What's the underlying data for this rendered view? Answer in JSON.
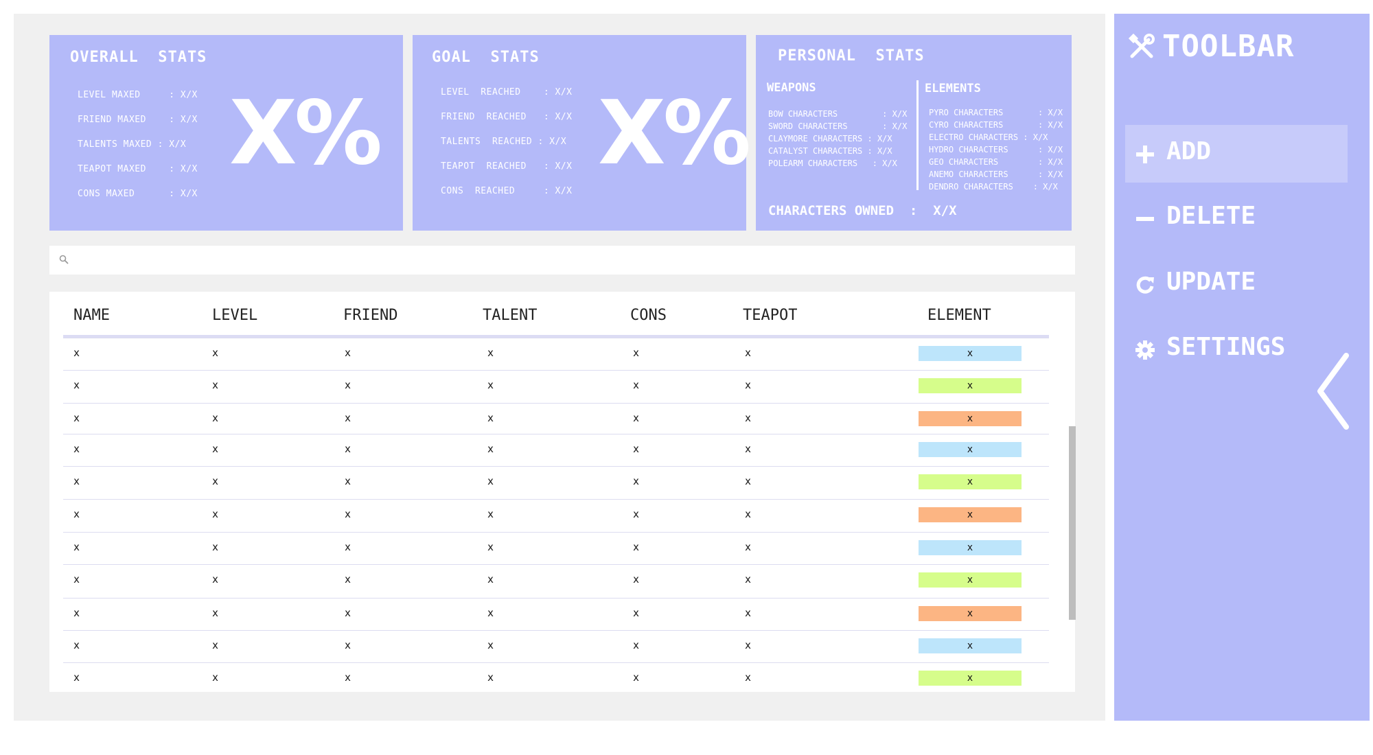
{
  "cards": {
    "overall": {
      "title": "OVERALL  STATS",
      "rows": [
        "LEVEL MAXED     : X/X",
        "FRIEND MAXED    : X/X",
        "TALENTS MAXED : X/X",
        "TEAPOT MAXED    : X/X",
        "CONS MAXED      : X/X"
      ],
      "percent": "X%"
    },
    "goal": {
      "title": "GOAL  STATS",
      "rows": [
        "LEVEL  REACHED    : X/X",
        "FRIEND  REACHED   : X/X",
        "TALENTS  REACHED : X/X",
        "TEAPOT  REACHED   : X/X",
        "CONS  REACHED     : X/X"
      ],
      "percent": "X%"
    },
    "personal": {
      "title": "PERSONAL  STATS",
      "weapons_heading": "WEAPONS",
      "weapons": [
        "BOW CHARACTERS         : X/X",
        "SWORD CHARACTERS       : X/X",
        "CLAYMORE CHARACTERS : X/X",
        "CATALYST CHARACTERS : X/X",
        "POLEARM CHARACTERS   : X/X"
      ],
      "elements_heading": "ELEMENTS",
      "elements": [
        "PYRO CHARACTERS       : X/X",
        "CYRO CHARACTERS       : X/X",
        "ELECTRO CHARACTERS : X/X",
        "HYDRO CHARACTERS      : X/X",
        "GEO CHARACTERS        : X/X",
        "ANEMO CHARACTERS      : X/X",
        "DENDRO CHARACTERS    : X/X"
      ],
      "owned": "CHARACTERS OWNED  :  X/X"
    }
  },
  "search": {
    "placeholder": "",
    "icon": "search-icon"
  },
  "table": {
    "headers": [
      "NAME",
      "LEVEL",
      "FRIEND",
      "TALENT",
      "CONS",
      "TEAPOT",
      "ELEMENT"
    ],
    "rows": [
      {
        "name": "x",
        "level": "x",
        "friend": "x",
        "talent": "x",
        "cons": "x",
        "teapot": "x",
        "element": "x",
        "element_color": "#bde5fb"
      },
      {
        "name": "x",
        "level": "x",
        "friend": "x",
        "talent": "x",
        "cons": "x",
        "teapot": "x",
        "element": "x",
        "element_color": "#d6fd8b"
      },
      {
        "name": "x",
        "level": "x",
        "friend": "x",
        "talent": "x",
        "cons": "x",
        "teapot": "x",
        "element": "x",
        "element_color": "#fcb583"
      },
      {
        "name": "x",
        "level": "x",
        "friend": "x",
        "talent": "x",
        "cons": "x",
        "teapot": "x",
        "element": "x",
        "element_color": "#bde5fb"
      },
      {
        "name": "x",
        "level": "x",
        "friend": "x",
        "talent": "x",
        "cons": "x",
        "teapot": "x",
        "element": "x",
        "element_color": "#d6fd8b"
      },
      {
        "name": "x",
        "level": "x",
        "friend": "x",
        "talent": "x",
        "cons": "x",
        "teapot": "x",
        "element": "x",
        "element_color": "#fcb583"
      },
      {
        "name": "x",
        "level": "x",
        "friend": "x",
        "talent": "x",
        "cons": "x",
        "teapot": "x",
        "element": "x",
        "element_color": "#bde5fb"
      },
      {
        "name": "x",
        "level": "x",
        "friend": "x",
        "talent": "x",
        "cons": "x",
        "teapot": "x",
        "element": "x",
        "element_color": "#d6fd8b"
      },
      {
        "name": "x",
        "level": "x",
        "friend": "x",
        "talent": "x",
        "cons": "x",
        "teapot": "x",
        "element": "x",
        "element_color": "#fcb583"
      },
      {
        "name": "x",
        "level": "x",
        "friend": "x",
        "talent": "x",
        "cons": "x",
        "teapot": "x",
        "element": "x",
        "element_color": "#bde5fb"
      },
      {
        "name": "x",
        "level": "x",
        "friend": "x",
        "talent": "x",
        "cons": "x",
        "teapot": "x",
        "element": "x",
        "element_color": "#d6fd8b"
      }
    ]
  },
  "toolbar": {
    "title": "TOOLBAR",
    "title_icon": "tools-icon",
    "items": [
      {
        "label": "ADD",
        "icon": "plus-icon"
      },
      {
        "label": "DELETE",
        "icon": "minus-icon"
      },
      {
        "label": "UPDATE",
        "icon": "refresh-icon"
      },
      {
        "label": "SETTINGS",
        "icon": "gear-icon"
      }
    ],
    "collapse_icon": "chevron-left-icon"
  },
  "colors": {
    "accent": "#b4baf9",
    "panel_bg": "#f0f0f0",
    "pyro": "#fcb583",
    "dendro": "#d6fd8b",
    "hydro": "#bde5fb"
  }
}
